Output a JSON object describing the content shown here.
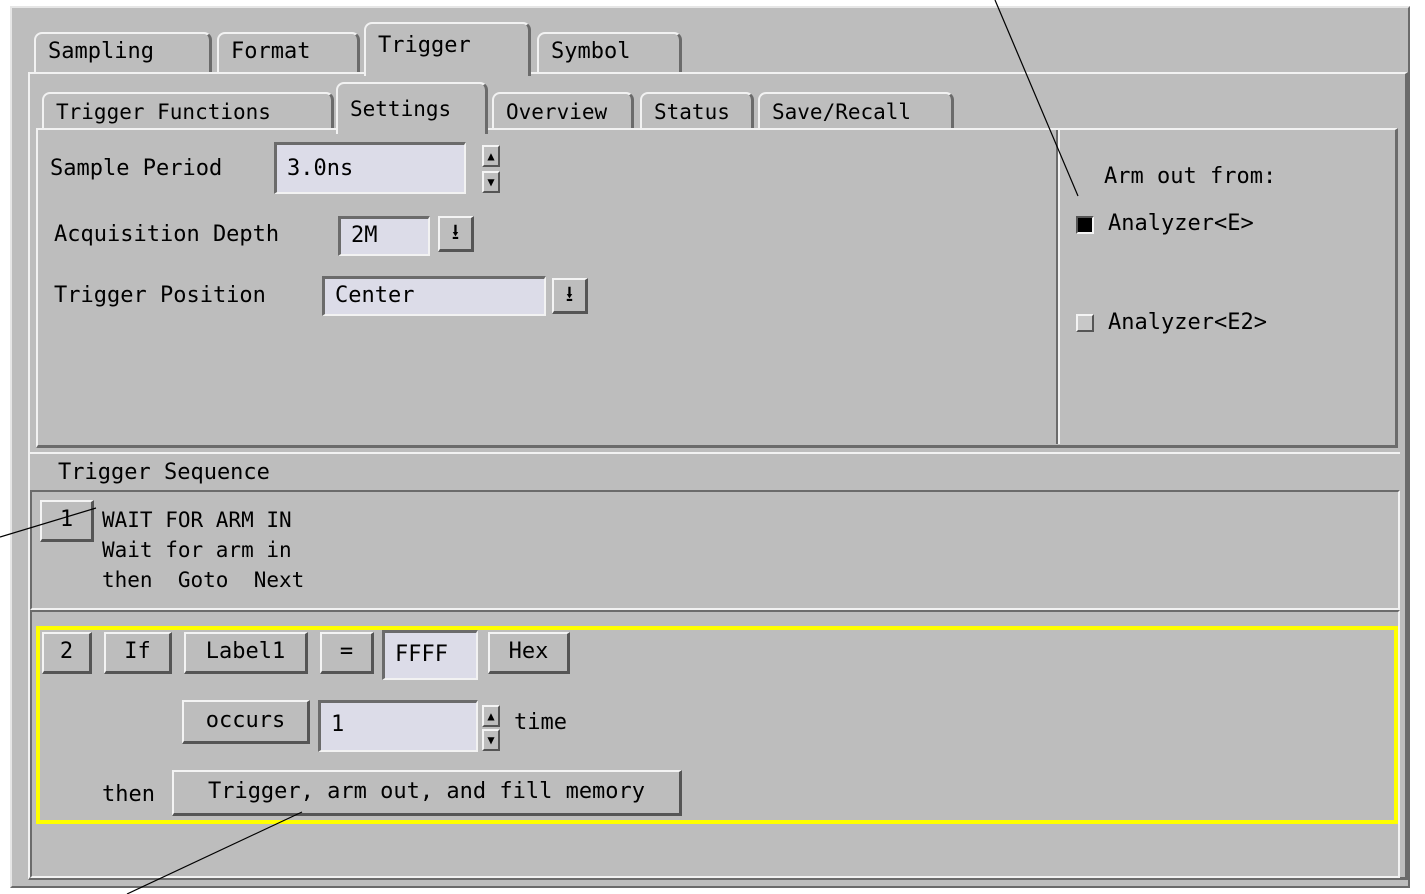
{
  "main_tabs": [
    "Sampling",
    "Format",
    "Trigger",
    "Symbol"
  ],
  "sub_tabs": [
    "Trigger Functions",
    "Settings",
    "Overview",
    "Status",
    "Save/Recall"
  ],
  "settings": {
    "sample_period_label": "Sample Period",
    "sample_period_value": "3.0ns",
    "acq_depth_label": "Acquisition Depth",
    "acq_depth_value": "2M",
    "trigger_position_label": "Trigger Position",
    "trigger_position_value": "Center"
  },
  "arm_out": {
    "title": "Arm out from:",
    "options": [
      "Analyzer<E>",
      "Analyzer<E2>"
    ],
    "selected_index": 0
  },
  "sequence": {
    "title": "Trigger Sequence",
    "step1": {
      "number": "1",
      "line1": "WAIT FOR ARM IN",
      "line2": "Wait for arm in",
      "line3": "then  Goto  Next"
    },
    "step2": {
      "number": "2",
      "if_label": "If",
      "label_button": "Label1",
      "operator": "=",
      "value": "FFFF",
      "base": "Hex",
      "occurs_button": "occurs",
      "occurs_value": "1",
      "time_label": "time",
      "then_label": "then",
      "action_button": "Trigger, arm out, and fill memory"
    }
  },
  "colors": {
    "background": "#bdbdbd",
    "field": "#dcdce8",
    "highlight": "#ffff00"
  },
  "icons": {
    "spin_up": "triangle-up-icon",
    "spin_down": "triangle-down-icon",
    "dropdown": "arrow-down-bar-icon",
    "radio": "radio-square-icon"
  }
}
